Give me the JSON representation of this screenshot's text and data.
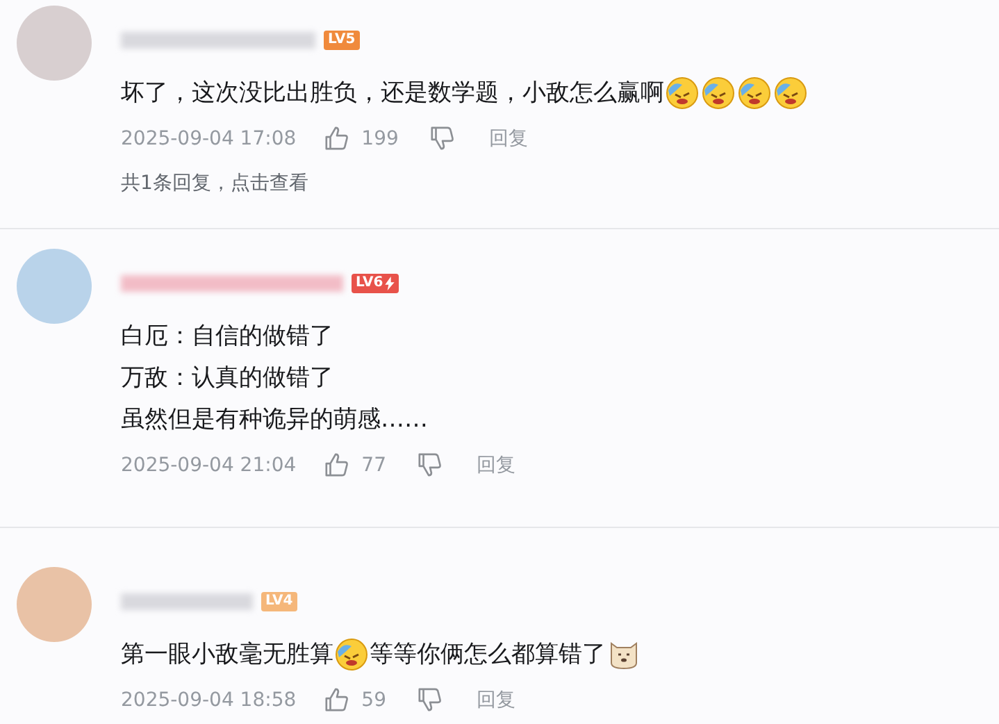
{
  "comments": [
    {
      "level_badge": {
        "text": "LV5",
        "color": "#f08a3c",
        "bolt": false
      },
      "content": [
        [
          {
            "kind": "text",
            "text": "坏了，这次没比出胜负，还是数学题，小敌怎么赢啊"
          },
          {
            "kind": "cry"
          },
          {
            "kind": "cry"
          },
          {
            "kind": "cry"
          },
          {
            "kind": "cry"
          }
        ]
      ],
      "time": "2025-09-04 17:08",
      "likes": "199",
      "reply_label": "回复",
      "replies_link": "共1条回复，点击查看"
    },
    {
      "level_badge": {
        "text": "LV6",
        "color": "#e8524a",
        "bolt": true
      },
      "content": [
        [
          {
            "kind": "text",
            "text": "白厄：自信的做错了"
          }
        ],
        [
          {
            "kind": "text",
            "text": "万敌：认真的做错了"
          }
        ],
        [
          {
            "kind": "text",
            "text": "虽然但是有种诡异的萌感……"
          }
        ]
      ],
      "time": "2025-09-04 21:04",
      "likes": "77",
      "reply_label": "回复"
    },
    {
      "level_badge": {
        "text": "LV4",
        "color": "#f5b77a",
        "bolt": false
      },
      "content": [
        [
          {
            "kind": "text",
            "text": "第一眼小敌毫无胜算"
          },
          {
            "kind": "cry"
          },
          {
            "kind": "text",
            "text": "等等你俩怎么都算错了"
          },
          {
            "kind": "dog"
          }
        ]
      ],
      "time": "2025-09-04 18:58",
      "likes": "59",
      "reply_label": "回复"
    }
  ]
}
